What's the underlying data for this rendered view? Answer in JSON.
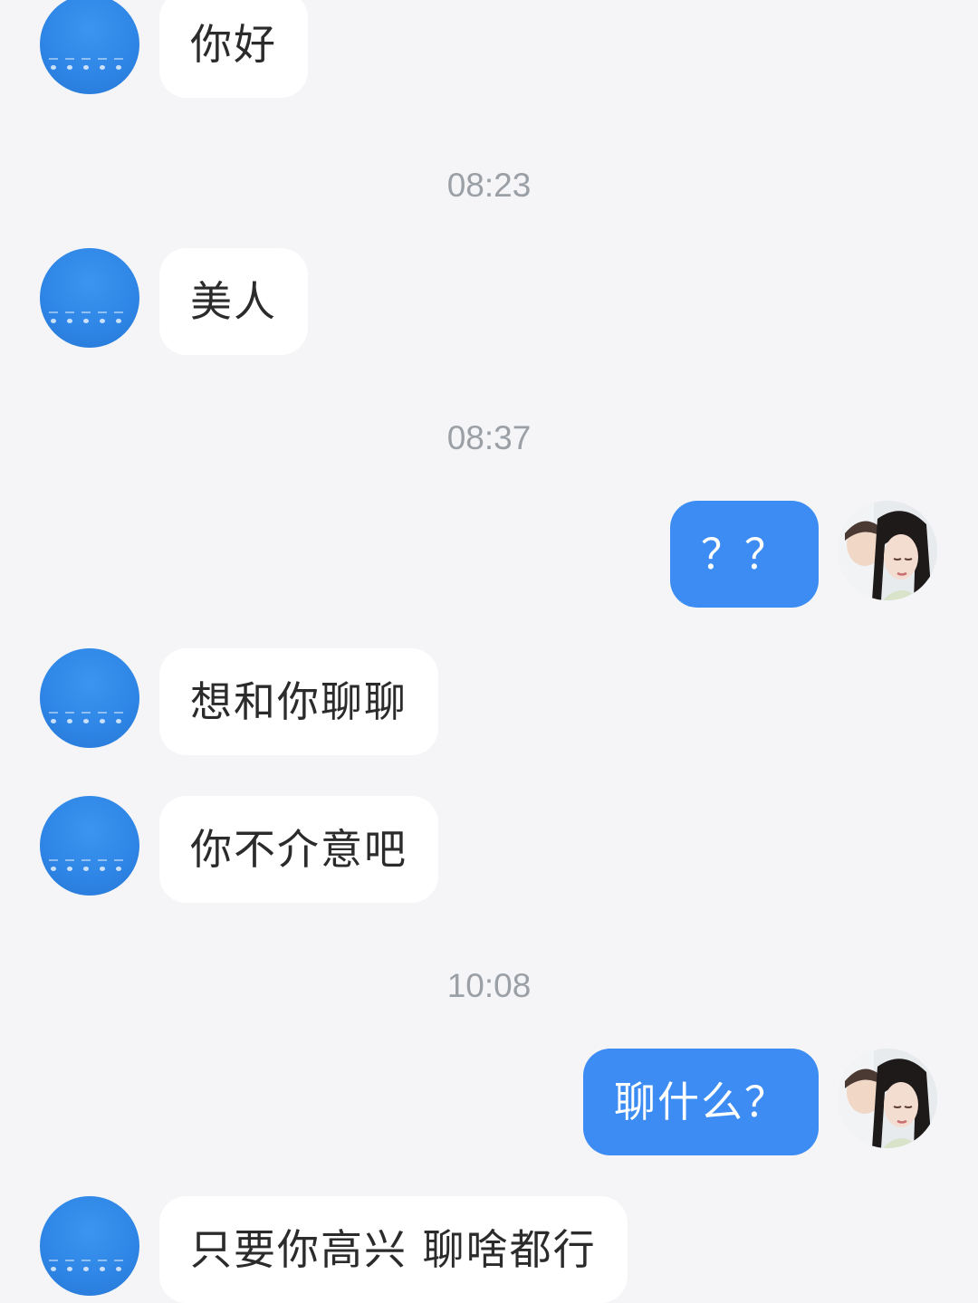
{
  "messages": [
    {
      "side": "left",
      "text": "你好"
    },
    {
      "timestamp": "08:23"
    },
    {
      "side": "left",
      "text": "美人"
    },
    {
      "timestamp": "08:37"
    },
    {
      "side": "right",
      "text": "？？"
    },
    {
      "side": "left",
      "text": "想和你聊聊"
    },
    {
      "side": "left",
      "text": "你不介意吧"
    },
    {
      "timestamp": "10:08"
    },
    {
      "side": "right",
      "text": "聊什么？"
    },
    {
      "side": "left",
      "text": "只要你高兴 聊啥都行"
    }
  ],
  "colors": {
    "background": "#f5f5f7",
    "incoming_bubble": "#ffffff",
    "outgoing_bubble": "#3c8cf3",
    "timestamp": "#9aa0a6"
  },
  "icons": {
    "contact_avatar": "weather-screenshot-avatar",
    "self_avatar": "user-photo-avatar"
  }
}
